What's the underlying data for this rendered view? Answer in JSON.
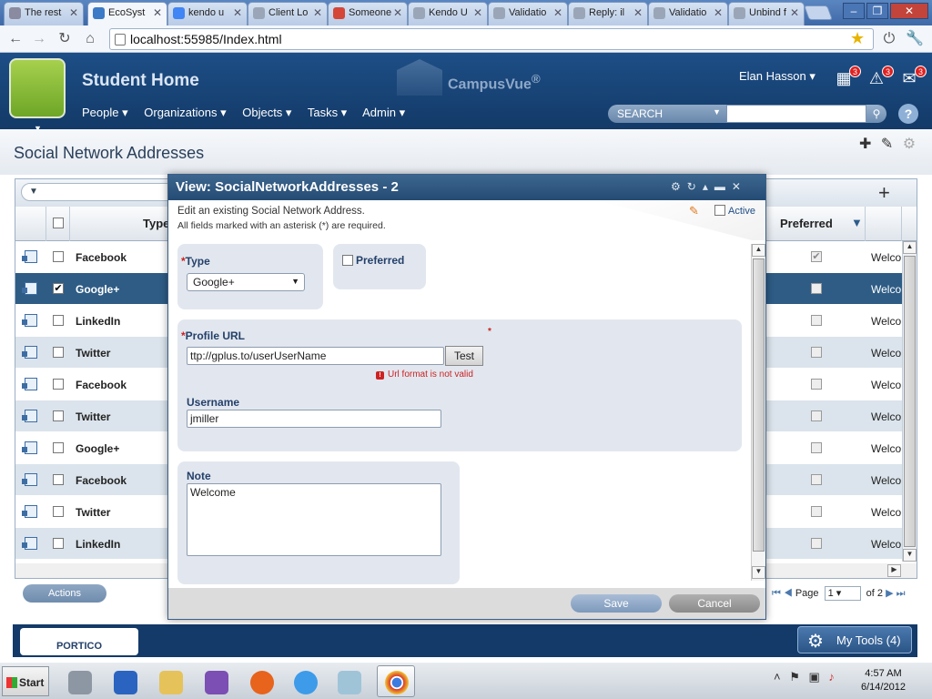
{
  "browser": {
    "tabs": [
      {
        "label": "The rest",
        "color": "#8a8aa0",
        "active": false
      },
      {
        "label": "EcoSyst",
        "color": "#3b7ac6",
        "active": true
      },
      {
        "label": "kendo u",
        "color": "#4285f4",
        "active": false
      },
      {
        "label": "Client Lo",
        "color": "#9aa6b8",
        "active": false
      },
      {
        "label": "Someone",
        "color": "#d44638",
        "active": false
      },
      {
        "label": "Kendo U",
        "color": "#9aa6b8",
        "active": false
      },
      {
        "label": "Validatio",
        "color": "#9aa6b8",
        "active": false
      },
      {
        "label": "Reply: il",
        "color": "#9aa6b8",
        "active": false
      },
      {
        "label": "Validatio",
        "color": "#9aa6b8",
        "active": false
      },
      {
        "label": "Unbind f",
        "color": "#9aa6b8",
        "active": false
      }
    ],
    "url": "localhost:55985/Index.html",
    "window_controls": {
      "minimize": "–",
      "restore": "❐",
      "close": "✕"
    }
  },
  "app": {
    "title": "Student Home",
    "brand": "CampusVue",
    "brand_mark": "®",
    "user": "Elan Hasson ▾",
    "badges": {
      "calendar": "3",
      "alerts": "3",
      "messages": "3"
    },
    "menu": [
      "People ▾",
      "Organizations ▾",
      "Objects ▾",
      "Tasks ▾",
      "Admin ▾"
    ],
    "search_scope": "SEARCH",
    "help": "?"
  },
  "page": {
    "title": "Social Network Addresses"
  },
  "grid": {
    "columns": {
      "type": "Type",
      "preferred": "Preferred"
    },
    "rows": [
      {
        "type": "Facebook",
        "checked": false,
        "preferred": true,
        "note": "Welco",
        "selected": false
      },
      {
        "type": "Google+",
        "checked": true,
        "preferred": false,
        "note": "Welco",
        "selected": true
      },
      {
        "type": "LinkedIn",
        "checked": false,
        "preferred": false,
        "note": "Welco",
        "selected": false
      },
      {
        "type": "Twitter",
        "checked": false,
        "preferred": false,
        "note": "Welco",
        "selected": false
      },
      {
        "type": "Facebook",
        "checked": false,
        "preferred": false,
        "note": "Welco",
        "selected": false
      },
      {
        "type": "Twitter",
        "checked": false,
        "preferred": false,
        "note": "Welco",
        "selected": false
      },
      {
        "type": "Google+",
        "checked": false,
        "preferred": false,
        "note": "Welco",
        "selected": false
      },
      {
        "type": "Facebook",
        "checked": false,
        "preferred": false,
        "note": "Welco",
        "selected": false
      },
      {
        "type": "Twitter",
        "checked": false,
        "preferred": false,
        "note": "Welco",
        "selected": false
      },
      {
        "type": "LinkedIn",
        "checked": false,
        "preferred": false,
        "note": "Welco",
        "selected": false
      }
    ],
    "actions_label": "Actions",
    "pager": {
      "page_label": "Page",
      "page": "1",
      "of": "of 2"
    }
  },
  "dialog": {
    "title": "View: SocialNetworkAddresses - 2",
    "subtitle": "Edit an existing Social Network Address.",
    "required_note": "All fields marked with an asterisk (*) are required.",
    "active_label": "Active",
    "type_label": "Type",
    "type_value": "Google+",
    "preferred_label": "Preferred",
    "profile_url_label": "Profile URL",
    "profile_url_value": "ttp://gplus.to/userUserName",
    "test_label": "Test",
    "error": "Url format is not valid",
    "username_label": "Username",
    "username_value": "jmiller",
    "note_label": "Note",
    "note_value": "Welcome",
    "save_label": "Save",
    "cancel_label": "Cancel",
    "asterisk": "*"
  },
  "footer": {
    "portico": "PORTICO",
    "my_tools": "My Tools (4)"
  },
  "taskbar": {
    "start": "Start",
    "time": "4:57 AM",
    "date": "6/14/2012"
  }
}
